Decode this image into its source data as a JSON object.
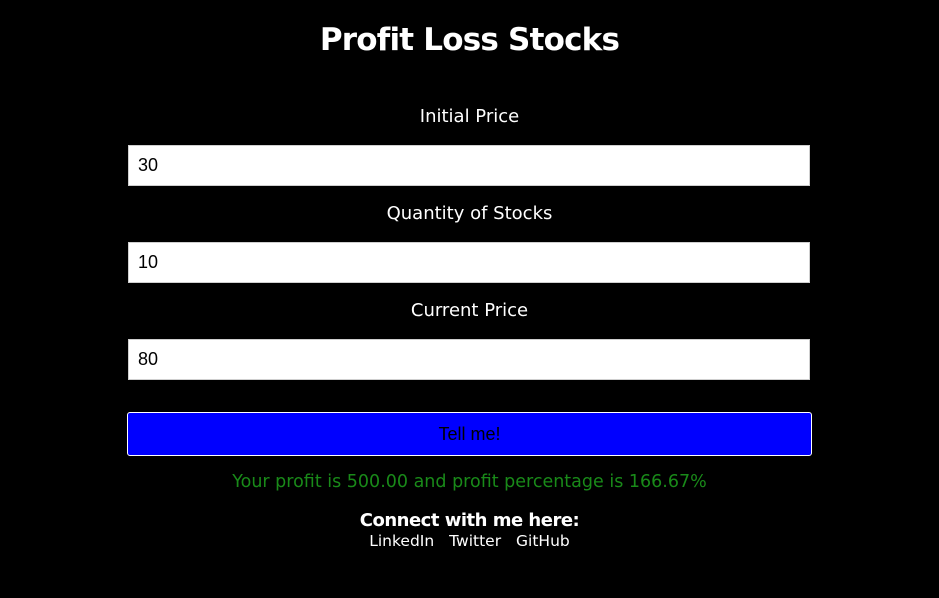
{
  "header": {
    "title": "Profit Loss Stocks"
  },
  "form": {
    "initial_price": {
      "label": "Initial Price",
      "value": "30"
    },
    "quantity": {
      "label": "Quantity of Stocks",
      "value": "10"
    },
    "current_price": {
      "label": "Current Price",
      "value": "80"
    },
    "submit_label": "Tell me!"
  },
  "result": {
    "message": "Your profit is 500.00 and profit percentage is 166.67%",
    "color": "#198a19"
  },
  "footer": {
    "heading": "Connect with me here:",
    "links": [
      "LinkedIn",
      "Twitter",
      "GitHub"
    ]
  },
  "colors": {
    "background": "#000000",
    "button": "#0000ff",
    "text": "#ffffff"
  }
}
